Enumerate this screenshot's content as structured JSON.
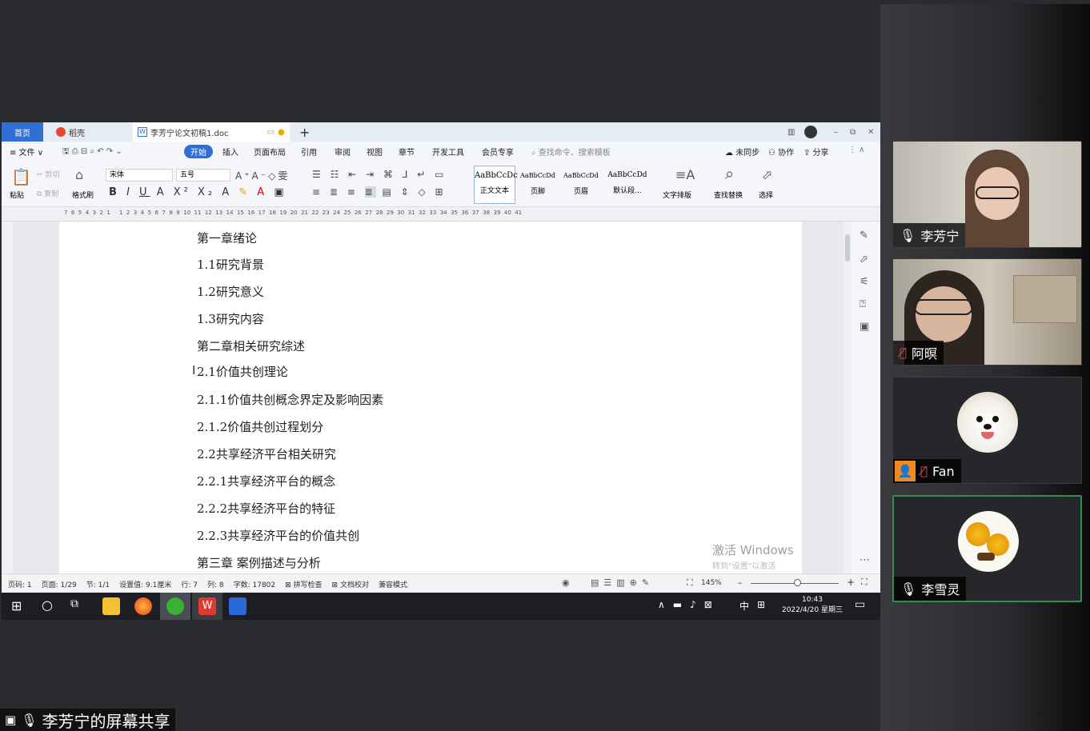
{
  "wps": {
    "tabs": {
      "home": "首页",
      "daoke": "稻壳",
      "doc": "李芳宁论文初稿1.doc"
    },
    "menus": [
      "≡ 文件 ∨",
      "开始",
      "插入",
      "页面布局",
      "引用",
      "审阅",
      "视图",
      "章节",
      "开发工具",
      "会员专享"
    ],
    "search_placeholder": "查找命令、搜索模板",
    "right_menu": {
      "sync": "未同步",
      "collab": "协作",
      "share": "分享"
    },
    "toolbar": {
      "paste": "粘贴",
      "cut": "剪切",
      "copy": "复制",
      "format_painter": "格式刷",
      "font": "宋体",
      "size": "五号",
      "styles": [
        {
          "preview": "AaBbCcDc",
          "name": "正文文本"
        },
        {
          "preview": "AaBbCcDd",
          "name": "页脚"
        },
        {
          "preview": "AaBbCcDd",
          "name": "页眉"
        },
        {
          "preview": "AaBbCcDd",
          "name": "默认段..."
        }
      ],
      "text_layout": "文字排版",
      "find_replace": "查找替换",
      "select": "选择"
    },
    "ruler_numbers": "7  6  5  4  3  2  1     1  2  3  4  5  6  7  8  9  10  11  12  13  14  15  16  17  18  19  20  21  22  23  24  25  26  27  28  29  30  31  32  33  34  35  36  37  38  39  40  41",
    "lines": [
      "第一章绪论",
      "1.1研究背景",
      "1.2研究意义",
      "1.3研究内容",
      "第二章相关研究综述",
      "2.1价值共创理论",
      "2.1.1价值共创概念界定及影响因素",
      "2.1.2价值共创过程划分",
      "2.2共享经济平台相关研究",
      "2.2.1共享经济平台的概念",
      "2.2.2共享经济平台的特征",
      "2.2.3共享经济平台的价值共创",
      "第三章  案例描述与分析"
    ],
    "watermark": {
      "line1": "激活 Windows",
      "line2": "转到\"设置\"以激活 Windows。"
    },
    "status": {
      "page_num": "页码: 1",
      "pages": "页面: 1/29",
      "section": "节: 1/1",
      "setting": "设置值: 9.1厘米",
      "row": "行: 7",
      "col": "列: 8",
      "words": "字数: 17802",
      "spell": "拼写检查",
      "proof": "文档校对",
      "compat": "兼容模式",
      "zoom": "145%"
    },
    "clock": {
      "time": "10:43",
      "date": "2022/4/20 星期三"
    },
    "tray_lang": "中"
  },
  "participants": [
    {
      "name": "李芳宁",
      "mic": "on"
    },
    {
      "name": "阿暝",
      "mic": "muted"
    },
    {
      "name": "Fan",
      "mic": "muted"
    },
    {
      "name": "李雪灵",
      "mic": "on"
    }
  ],
  "share_label": "李芳宁的屏幕共享",
  "colors": {
    "accent_blue": "#2f6fd6",
    "active_speaker": "#2f8f4e",
    "muted_red": "#e04848"
  }
}
